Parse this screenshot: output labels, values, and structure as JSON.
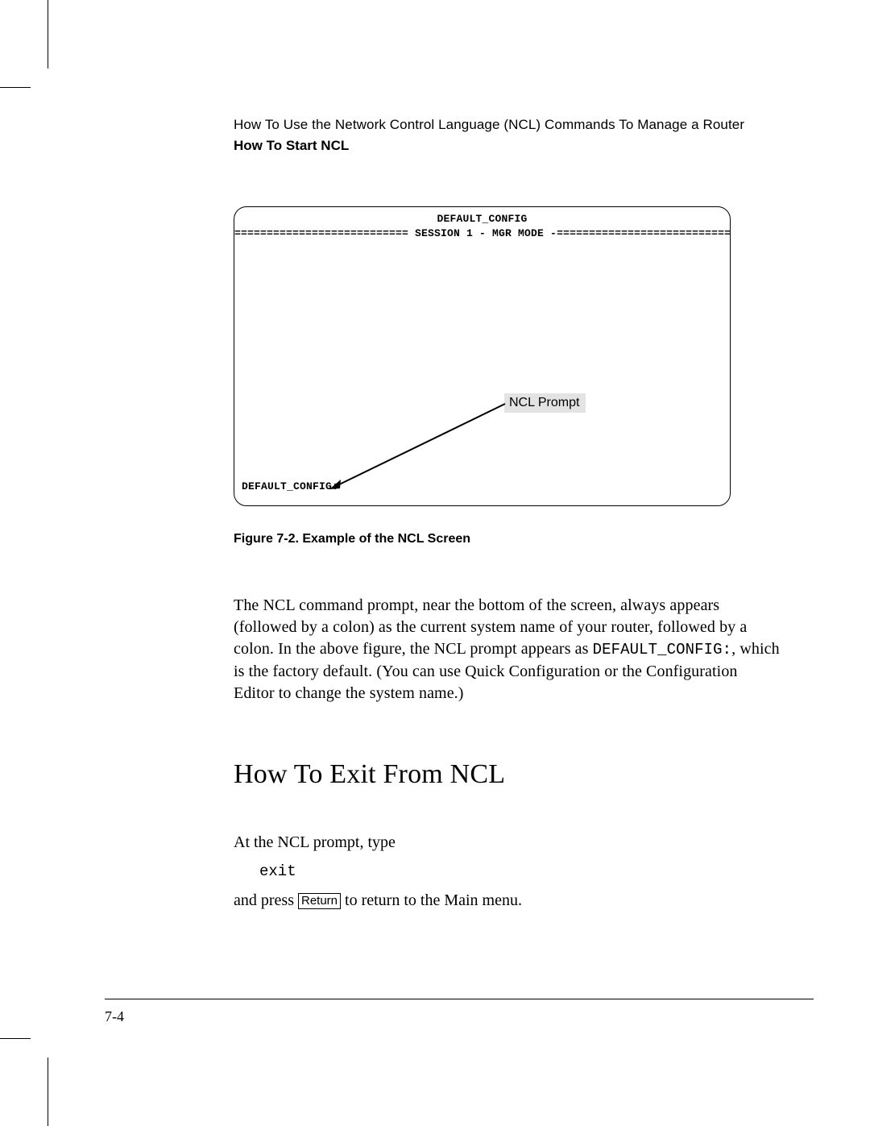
{
  "header": {
    "chapter_title": "How To Use the Network Control Language (NCL) Commands To Manage a Router",
    "section_title": "How To Start NCL"
  },
  "figure": {
    "screen": {
      "title": "DEFAULT_CONFIG",
      "separator": "=========================== SESSION 1 - MGR MODE -=============================",
      "prompt": "DEFAULT_CONFIG:"
    },
    "callout_label": "NCL Prompt",
    "caption": "Figure  7-2.   Example of the NCL Screen"
  },
  "body": {
    "para_pre": "The NCL command prompt, near the bottom of the screen, always appears (followed by a colon) as the current system name of your router, followed by a colon. In the above figure, the NCL prompt appears as ",
    "para_code": "DEFAULT_CONFIG:",
    "para_post": ", which is the factory default. (You can use Quick Configuration or the Configuration Editor to change the system name.)"
  },
  "section2": {
    "heading": "How To Exit From NCL",
    "line1": "At the NCL prompt, type",
    "command": "exit",
    "line3_pre": "and press ",
    "keycap": "Return",
    "line3_post": " to return to the Main menu."
  },
  "page_number": "7-4"
}
